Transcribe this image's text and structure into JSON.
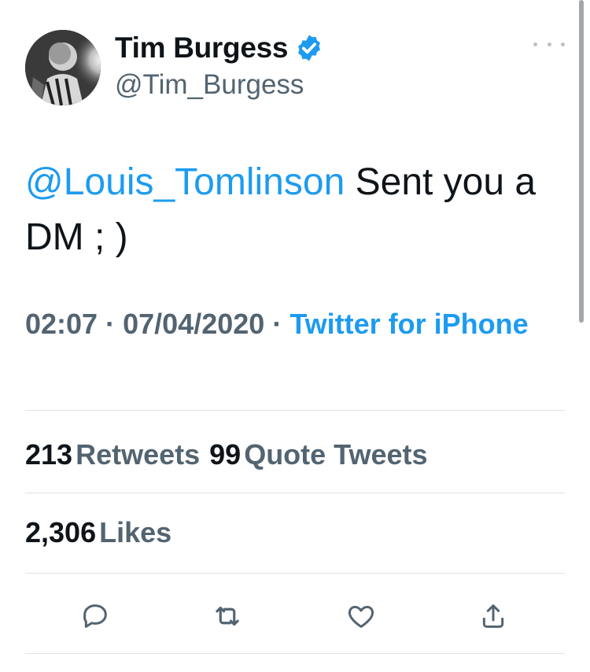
{
  "author": {
    "display_name": "Tim Burgess",
    "handle": "@Tim_Burgess",
    "verified": true,
    "avatar_icon": "profile-photo"
  },
  "tweet": {
    "mention": "@Louis_Tomlinson",
    "text": " Sent you a DM ; )"
  },
  "meta": {
    "time": "02:07",
    "separator": "·",
    "date": "07/04/2020",
    "source": "Twitter for iPhone"
  },
  "stats": {
    "retweets_count": "213",
    "retweets_label": "Retweets",
    "quotes_count": "99",
    "quotes_label": "Quote Tweets",
    "likes_count": "2,306",
    "likes_label": "Likes"
  },
  "actions": [
    "reply-icon",
    "retweet-icon",
    "like-icon",
    "share-icon"
  ],
  "colors": {
    "accent": "#1d9bf0",
    "text": "#0f1419",
    "secondary": "#536471",
    "divider": "#dde3e8"
  }
}
